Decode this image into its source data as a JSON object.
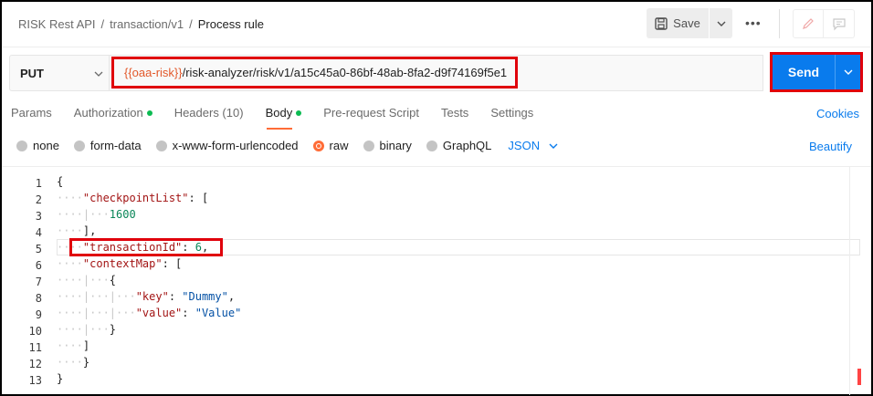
{
  "breadcrumb": {
    "collection": "RISK Rest API",
    "folder": "transaction/v1",
    "request": "Process rule",
    "sep": "/"
  },
  "header": {
    "save_label": "Save",
    "more_label": "•••"
  },
  "request": {
    "method": "PUT",
    "url_var": "{{oaa-risk}}",
    "url_path": "/risk-analyzer/risk/v1/a15c45a0-86bf-48ab-8fa2-d9f74169f5e1",
    "send_label": "Send"
  },
  "tabs": [
    {
      "label": "Params"
    },
    {
      "label": "Authorization"
    },
    {
      "label": "Headers (10)"
    },
    {
      "label": "Body"
    },
    {
      "label": "Pre-request Script"
    },
    {
      "label": "Tests"
    },
    {
      "label": "Settings"
    }
  ],
  "cookies_label": "Cookies",
  "body_types": [
    "none",
    "form-data",
    "x-www-form-urlencoded",
    "raw",
    "binary",
    "GraphQL"
  ],
  "body_format": "JSON",
  "beautify_label": "Beautify",
  "line_numbers": [
    "1",
    "2",
    "3",
    "4",
    "5",
    "6",
    "7",
    "8",
    "9",
    "10",
    "11",
    "12",
    "13"
  ],
  "colors": {
    "accent": "#097bed",
    "active_tab": "#ff6c37",
    "highlight": "#e0000b"
  }
}
